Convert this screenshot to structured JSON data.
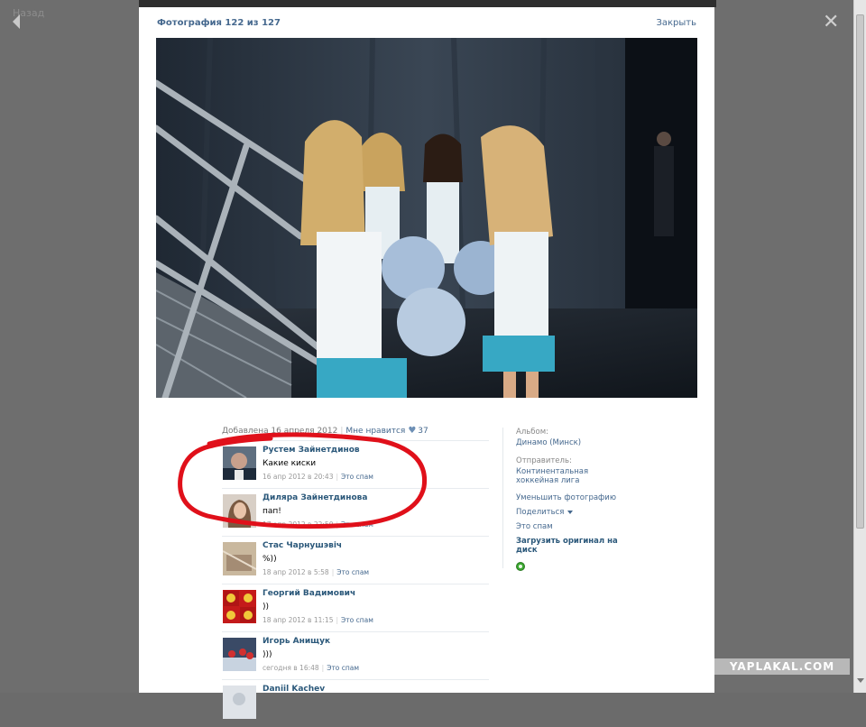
{
  "nav": {
    "back_label": "Назад"
  },
  "viewer": {
    "counter": "Фотография 122 из 127",
    "close_label": "Закрыть"
  },
  "meta": {
    "added": "Добавлена 16 апреля 2012",
    "like_label": "Мне нравится",
    "like_count": "37"
  },
  "comments": [
    {
      "name": "Рустем Зайнетдинов",
      "text": "Какие киски",
      "date": "16 апр 2012 в 20:43",
      "spam": "Это спам"
    },
    {
      "name": "Диляра Зайнетдинова",
      "text": "пап!",
      "date": "17 апр 2012 в 22:50",
      "spam": "Это спам"
    },
    {
      "name": "Стас Чарнушэвіч",
      "text": "%))",
      "date": "18 апр 2012 в 5:58",
      "spam": "Это спам"
    },
    {
      "name": "Георгий Вадимович",
      "text": "))",
      "date": "18 апр 2012 в 11:15",
      "spam": "Это спам"
    },
    {
      "name": "Игорь Анищук",
      "text": ")))",
      "date": "сегодня в 16:48",
      "spam": "Это спам"
    },
    {
      "name": "Daniil Kachev",
      "text": "",
      "date": "",
      "spam": ""
    }
  ],
  "sidebar": {
    "album_label": "Альбом:",
    "album_name": "Динамо (Минск)",
    "sender_label": "Отправитель:",
    "sender_name": "Континентальная хоккейная лига",
    "reduce_photo": "Уменьшить фотографию",
    "share": "Поделиться",
    "spam": "Это спам",
    "upload_original": "Загрузить оригинал на диск"
  },
  "watermark": "YAPLAKAL.COM",
  "colors": {
    "link": "#45688e",
    "name": "#2b587a",
    "annotation_red": "#e0101a"
  }
}
